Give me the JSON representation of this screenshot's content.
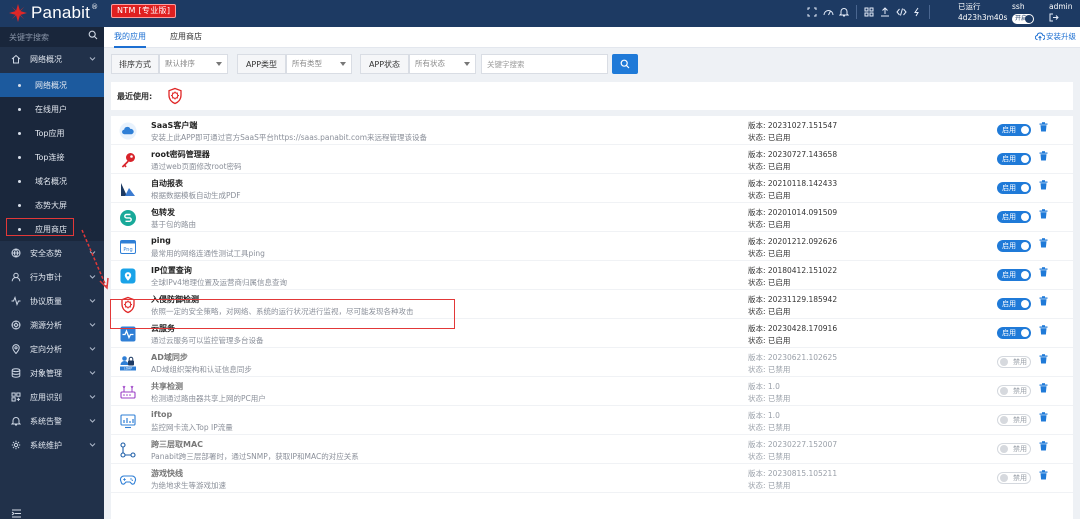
{
  "topbar": {
    "logo_text": "Panabit",
    "logo_reg": "®",
    "edition": "NTM [专业版]",
    "running_label": "已运行",
    "running_time": "4d23h3m40s",
    "ssh_label": "ssh",
    "ssh_toggle": "开启",
    "admin_label": "admin",
    "icons": [
      "expand-icon",
      "dashboard-icon",
      "bell-icon",
      "grid-icon",
      "upload-icon",
      "code-icon",
      "bolt-icon"
    ]
  },
  "sidebar": {
    "search_placeholder": "关键字搜索",
    "items": [
      {
        "label": "网络概况",
        "icon": "home-icon",
        "type": "group",
        "expanded": true
      },
      {
        "label": "网络概况",
        "type": "sub",
        "active": true
      },
      {
        "label": "在线用户",
        "type": "sub"
      },
      {
        "label": "Top应用",
        "type": "sub"
      },
      {
        "label": "Top连接",
        "type": "sub"
      },
      {
        "label": "域名概况",
        "type": "sub"
      },
      {
        "label": "态势大屏",
        "type": "sub"
      },
      {
        "label": "应用商店",
        "type": "sub",
        "highlighted": true
      },
      {
        "label": "安全态势",
        "icon": "globe-icon",
        "type": "group"
      },
      {
        "label": "行为审计",
        "icon": "user-icon",
        "type": "group"
      },
      {
        "label": "协议质量",
        "icon": "pulse-icon",
        "type": "group"
      },
      {
        "label": "溯源分析",
        "icon": "trace-icon",
        "type": "group"
      },
      {
        "label": "定向分析",
        "icon": "location-icon",
        "type": "group"
      },
      {
        "label": "对象管理",
        "icon": "database-icon",
        "type": "group"
      },
      {
        "label": "应用识别",
        "icon": "apps-icon",
        "type": "group"
      },
      {
        "label": "系统告警",
        "icon": "alarm-icon",
        "type": "group"
      },
      {
        "label": "系统维护",
        "icon": "settings-icon",
        "type": "group"
      }
    ]
  },
  "tabs": [
    {
      "label": "我的应用",
      "active": true
    },
    {
      "label": "应用商店",
      "active": false
    }
  ],
  "upgrade_label": "安装升级",
  "filters": {
    "sort_label": "排序方式",
    "sort_value": "默认排序",
    "type_label": "APP类型",
    "type_value": "所有类型",
    "status_label": "APP状态",
    "status_value": "所有状态",
    "keyword_placeholder": "关键字搜索"
  },
  "recent_label": "最近使用:",
  "apps": [
    {
      "name": "SaaS客户端",
      "desc": "安装上此APP即可通过官方SaaS平台https://saas.panabit.com来远程管理该设备",
      "version": "版本: 20231027.151547",
      "status": "状态: 已启用",
      "enabled": true,
      "toggle": "启用",
      "icon": "cloud-icon"
    },
    {
      "name": "root密码管理器",
      "desc": "通过web页面修改root密码",
      "version": "版本: 20230727.143658",
      "status": "状态: 已启用",
      "enabled": true,
      "toggle": "启用",
      "icon": "key-icon"
    },
    {
      "name": "自动报表",
      "desc": "根据数据模板自动生成PDF",
      "version": "版本: 20210118.142433",
      "status": "状态: 已启用",
      "enabled": true,
      "toggle": "启用",
      "icon": "report-icon"
    },
    {
      "name": "包转发",
      "desc": "基于包的路由",
      "version": "版本: 20201014.091509",
      "status": "状态: 已启用",
      "enabled": true,
      "toggle": "启用",
      "icon": "forward-icon"
    },
    {
      "name": "ping",
      "desc": "最常用的网络连通性测试工具ping",
      "version": "版本: 20201212.092626",
      "status": "状态: 已启用",
      "enabled": true,
      "toggle": "启用",
      "icon": "ping-icon"
    },
    {
      "name": "IP位置查询",
      "desc": "全球IPv4地理位置及运营商归属信息查询",
      "version": "版本: 20180412.151022",
      "status": "状态: 已启用",
      "enabled": true,
      "toggle": "启用",
      "icon": "ip-location-icon"
    },
    {
      "name": "入侵防御检测",
      "desc": "依照一定的安全策略，对网络、系统的运行状况进行监视，尽可能发现各种攻击",
      "version": "版本: 20231129.185942",
      "status": "状态: 已启用",
      "enabled": true,
      "toggle": "启用",
      "icon": "virus-shield-icon"
    },
    {
      "name": "云服务",
      "desc": "通过云服务可以监控管理多台设备",
      "version": "版本: 20230428.170916",
      "status": "状态: 已启用",
      "enabled": true,
      "toggle": "启用",
      "icon": "cloud-monitor-icon"
    },
    {
      "name": "AD域同步",
      "desc": "AD域组织架构和认证信息同步",
      "version": "版本: 20230621.102625",
      "status": "状态: 已禁用",
      "enabled": false,
      "toggle": "禁用",
      "icon": "ldap-icon"
    },
    {
      "name": "共享检测",
      "desc": "检测通过路由器共享上网的PC用户",
      "version": "版本: 1.0",
      "status": "状态: 已禁用",
      "enabled": false,
      "toggle": "禁用",
      "icon": "router-icon"
    },
    {
      "name": "iftop",
      "desc": "监控网卡流入Top IP流量",
      "version": "版本: 1.0",
      "status": "状态: 已禁用",
      "enabled": false,
      "toggle": "禁用",
      "icon": "chart-icon"
    },
    {
      "name": "跨三层取MAC",
      "desc": "Panabit跨三层部署时，通过SNMP，获取IP和MAC的对应关系",
      "version": "版本: 20230227.152007",
      "status": "状态: 已禁用",
      "enabled": false,
      "toggle": "禁用",
      "icon": "network-icon"
    },
    {
      "name": "游戏快线",
      "desc": "为绝地求生等游戏加速",
      "version": "版本: 20230815.105211",
      "status": "状态: 已禁用",
      "enabled": false,
      "toggle": "禁用",
      "icon": "gamepad-icon"
    }
  ],
  "colors": {
    "topbar": "#1d3a63",
    "sidebar": "#21314a",
    "accent": "#1f7ad8",
    "highlight_border": "#e23838"
  }
}
